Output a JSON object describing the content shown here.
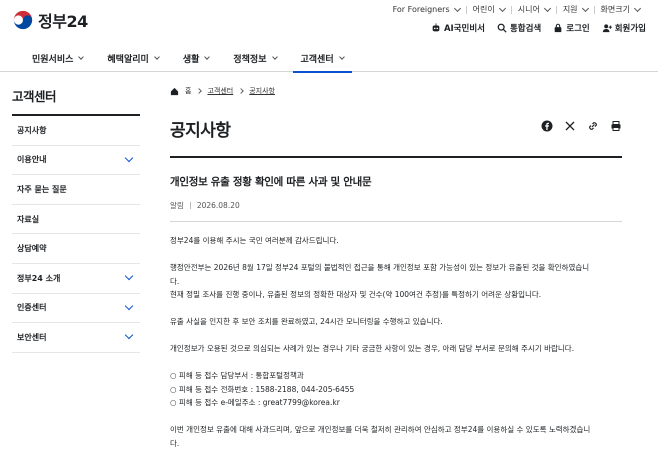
{
  "header": {
    "logo_text": "정부24",
    "util_top": [
      "For Foreigners",
      "어린이",
      "시니어",
      "지원",
      "화면크기"
    ],
    "util_main": [
      "AI국민비서",
      "통합검색",
      "로그인",
      "회원가입"
    ]
  },
  "gnb": {
    "items": [
      "민원서비스",
      "혜택알리미",
      "생활",
      "정책정보",
      "고객센터"
    ]
  },
  "sidebar": {
    "title": "고객센터",
    "items": [
      "공지사항",
      "이용안내",
      "자주 묻는 질문",
      "자료실",
      "상담예약",
      "정부24 소개",
      "인증센터",
      "보안센터"
    ]
  },
  "breadcrumb": {
    "home": "홈",
    "items": [
      "고객센터",
      "공지사항"
    ]
  },
  "page": {
    "title": "공지사항"
  },
  "post": {
    "title": "개인정보 유출 정황 확인에 따른 사과 및 안내문",
    "category": "알림",
    "date": "2026.08.20",
    "paragraphs": [
      "정부24를 이용해 주시는 국민 여러분께 감사드립니다.",
      "행정안전부는 2026년 8월 17일 정부24 포털의 불법적인 접근을 통해 개인정보 포함 가능성이 있는 정보가 유출된 것을 확인하였습니",
      "다.",
      "현재 정밀 조사를 진행 중이나, 유출된 정보의 정확한 대상자 및 건수(약 100여건 추정)를 특정하기 어려운 상황입니다.",
      "유출 사실을 인지한 후 보안 조치를 완료하였고, 24시간 모니터링을 수행하고 있습니다.",
      "개인정보가 오용된 것으로 의심되는 사례가 있는 경우나 기타 궁금한 사항이 있는 경우, 아래 담당 부서로 문의해 주시기 바랍니다.",
      "○ 피해 등 접수 담당부서 : 통합포털정책과",
      "○ 피해 등 접수 전화번호 : 1588-2188, 044-205-6455",
      "○ 피해 등 접수 e-메일주소 : great7799@korea.kr",
      "이번 개인정보 유출에 대해 사과드리며, 앞으로 개인정보를 더욱 철저히 관리하여 안심하고 정부24를 이용하실 수 있도록 노력하겠습니",
      "다."
    ]
  },
  "colors": {
    "accent": "#0b50d0",
    "text": "#1e2124",
    "border": "#d6d6d6"
  }
}
